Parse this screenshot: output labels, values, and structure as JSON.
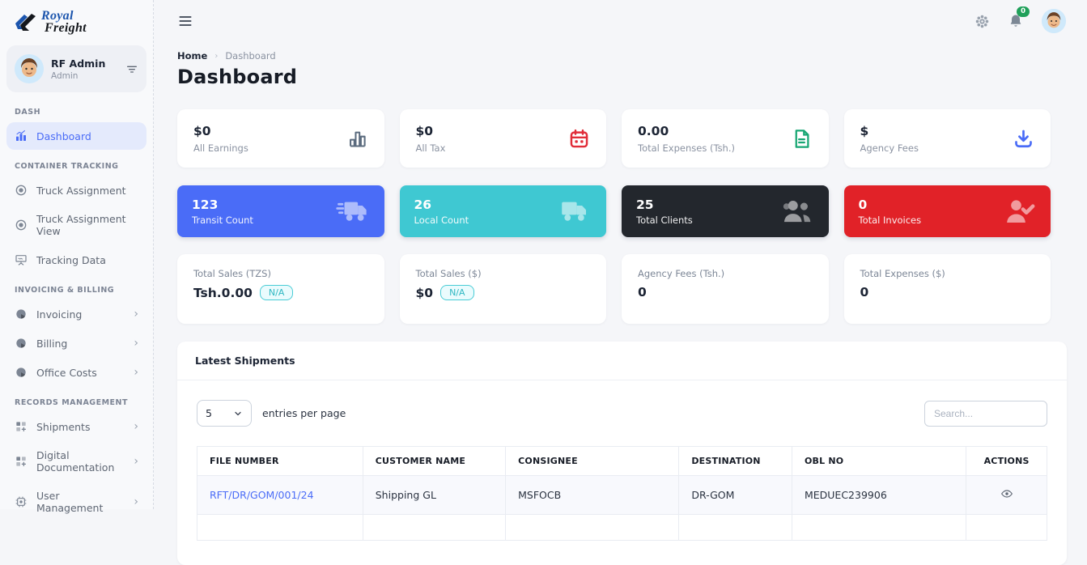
{
  "brand": {
    "line1": "Royal",
    "line2": "Freight"
  },
  "topbar": {
    "notification_badge": "0"
  },
  "sidebar": {
    "profile": {
      "name": "RF Admin",
      "role": "Admin"
    },
    "sections": [
      {
        "label": "DASH",
        "items": [
          {
            "label": "Dashboard",
            "icon": "chart-icon",
            "active": true,
            "chevron": false
          }
        ]
      },
      {
        "label": "CONTAINER TRACKING",
        "items": [
          {
            "label": "Truck Assignment",
            "icon": "record-icon",
            "active": false,
            "chevron": false
          },
          {
            "label": "Truck Assignment View",
            "icon": "record-icon",
            "active": false,
            "chevron": false
          },
          {
            "label": "Tracking Data",
            "icon": "presentation-icon",
            "active": false,
            "chevron": false
          }
        ]
      },
      {
        "label": "INVOICING & BILLING",
        "items": [
          {
            "label": "Invoicing",
            "icon": "pie-icon",
            "active": false,
            "chevron": true
          },
          {
            "label": "Billing",
            "icon": "pie-icon",
            "active": false,
            "chevron": true
          },
          {
            "label": "Office Costs",
            "icon": "pie-icon",
            "active": false,
            "chevron": true
          }
        ]
      },
      {
        "label": "RECORDS MANAGEMENT",
        "items": [
          {
            "label": "Shipments",
            "icon": "grid-plus-icon",
            "active": false,
            "chevron": true
          },
          {
            "label": "Digital Documentation",
            "icon": "grid-plus-icon",
            "active": false,
            "chevron": true
          },
          {
            "label": "User Management",
            "icon": "cpu-icon",
            "active": false,
            "chevron": true
          }
        ]
      }
    ]
  },
  "breadcrumb": {
    "home": "Home",
    "current": "Dashboard"
  },
  "page": {
    "title": "Dashboard"
  },
  "stat_row1": [
    {
      "value": "$0",
      "label": "All Earnings",
      "icon": "bar-chart-icon",
      "color": "#5b6b7e"
    },
    {
      "value": "$0",
      "label": "All Tax",
      "icon": "calendar-icon",
      "color": "#e12d39"
    },
    {
      "value": "0.00",
      "label": "Total Expenses (Tsh.)",
      "icon": "file-text-icon",
      "color": "#17a673"
    },
    {
      "value": "$",
      "label": "Agency Fees",
      "icon": "download-icon",
      "color": "#4a6cf7"
    }
  ],
  "stat_row2": [
    {
      "value": "123",
      "label": "Transit Count",
      "icon": "truck-fast-icon",
      "bg": "#4a6cf7"
    },
    {
      "value": "26",
      "label": "Local Count",
      "icon": "truck-icon",
      "bg": "#3fc8d2"
    },
    {
      "value": "25",
      "label": "Total Clients",
      "icon": "users-icon",
      "bg": "#23272d"
    },
    {
      "value": "0",
      "label": "Total Invoices",
      "icon": "user-check-icon",
      "bg": "#e12228"
    }
  ],
  "stat_row3": [
    {
      "label": "Total Sales (TZS)",
      "value": "Tsh.0.00",
      "badge": "N/A"
    },
    {
      "label": "Total Sales ($)",
      "value": "$0",
      "badge": "N/A"
    },
    {
      "label": "Agency Fees (Tsh.)",
      "value": "0",
      "badge": null
    },
    {
      "label": "Total Expenses ($)",
      "value": "0",
      "badge": null
    }
  ],
  "shipments": {
    "title": "Latest Shipments",
    "entries_value": "5",
    "entries_label": "entries per page",
    "search_placeholder": "Search...",
    "headers": [
      "FILE NUMBER",
      "CUSTOMER NAME",
      "CONSIGNEE",
      "DESTINATION",
      "OBL NO",
      "ACTIONS"
    ],
    "rows": [
      {
        "file_number": "RFT/DR/GOM/001/24",
        "customer_name": "Shipping GL",
        "consignee": "MSFOCB",
        "destination": "DR-GOM",
        "obl_no": "MEDUEC239906"
      }
    ]
  },
  "colors": {
    "accent_blue": "#4a6cf7",
    "teal": "#3fc8d2",
    "dark": "#23272d",
    "red": "#e12228",
    "green": "#17a673",
    "badge_green": "#1fa05a",
    "active_bg": "#e4eafc",
    "na_teal": "#2fb7c2"
  }
}
